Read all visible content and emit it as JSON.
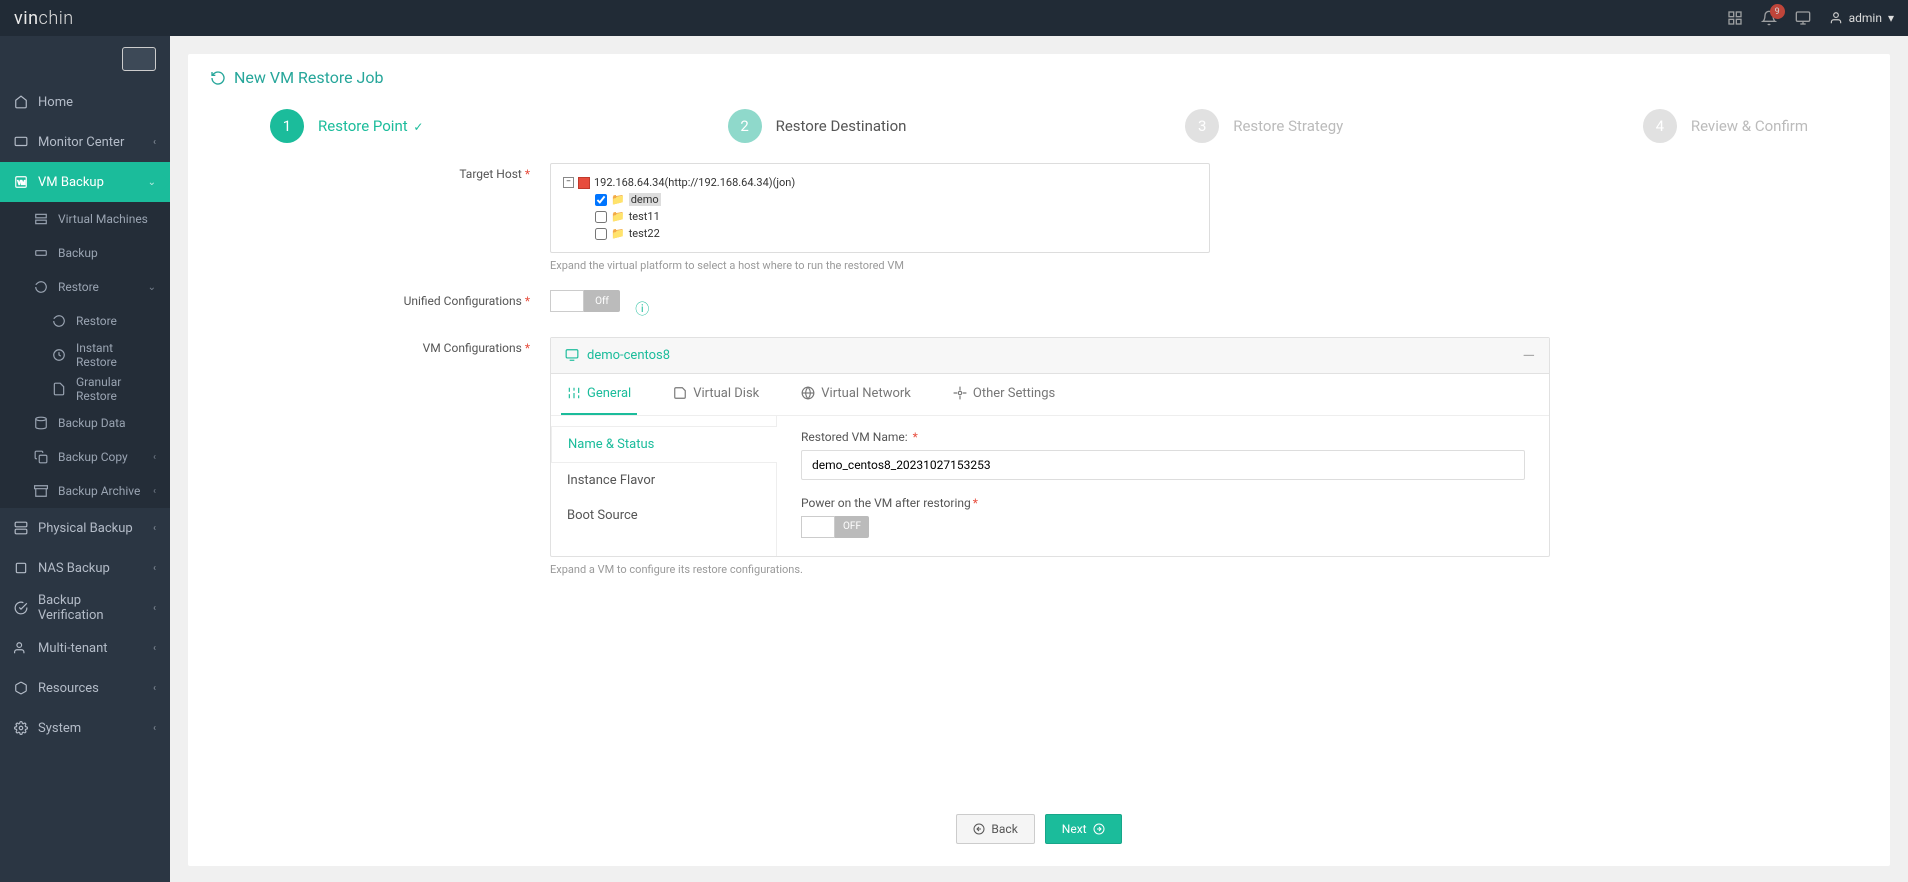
{
  "brand_prefix": "vin",
  "brand_suffix": "chin",
  "notification_count": "9",
  "user": {
    "name": "admin"
  },
  "sidebar": {
    "items": [
      {
        "label": "Home",
        "icon": "home"
      },
      {
        "label": "Monitor Center",
        "icon": "monitor",
        "expandable": true
      },
      {
        "label": "VM Backup",
        "icon": "vm",
        "expandable": true,
        "active": true
      },
      {
        "label": "Physical Backup",
        "icon": "physical",
        "expandable": true
      },
      {
        "label": "NAS Backup",
        "icon": "nas",
        "expandable": true
      },
      {
        "label": "Backup Verification",
        "icon": "verify",
        "expandable": true
      },
      {
        "label": "Multi-tenant",
        "icon": "tenant",
        "expandable": true
      },
      {
        "label": "Resources",
        "icon": "resources",
        "expandable": true
      },
      {
        "label": "System",
        "icon": "system",
        "expandable": true
      }
    ],
    "vm_sub": [
      {
        "label": "Virtual Machines"
      },
      {
        "label": "Backup"
      },
      {
        "label": "Restore",
        "expandable": true,
        "open": true
      },
      {
        "label": "Backup Data"
      },
      {
        "label": "Backup Copy",
        "expandable": true
      },
      {
        "label": "Backup Archive",
        "expandable": true
      }
    ],
    "restore_sub": [
      {
        "label": "Restore"
      },
      {
        "label": "Instant Restore"
      },
      {
        "label": "Granular Restore"
      }
    ]
  },
  "page": {
    "title": "New VM Restore Job"
  },
  "stepper": {
    "steps": [
      {
        "num": "1",
        "label": "Restore Point",
        "done": true
      },
      {
        "num": "2",
        "label": "Restore Destination",
        "current": true
      },
      {
        "num": "3",
        "label": "Restore Strategy"
      },
      {
        "num": "4",
        "label": "Review & Confirm"
      }
    ]
  },
  "form": {
    "target_host_label": "Target Host",
    "tree": {
      "root": "192.168.64.34(http://192.168.64.34)(jon)",
      "children": [
        {
          "label": "demo",
          "checked": true
        },
        {
          "label": "test11",
          "checked": false
        },
        {
          "label": "test22",
          "checked": false
        }
      ]
    },
    "target_host_hint": "Expand the virtual platform to select a host where to run the restored VM",
    "unified_label": "Unified Configurations",
    "unified_toggle_off": "Off",
    "vmconf_label": "VM Configurations",
    "vmconf_hint": "Expand a VM to configure its restore configurations."
  },
  "vmconf": {
    "vm_name": "demo-centos8",
    "tabs": [
      {
        "label": "General",
        "active": true
      },
      {
        "label": "Virtual Disk"
      },
      {
        "label": "Virtual Network"
      },
      {
        "label": "Other Settings"
      }
    ],
    "sublist": [
      {
        "label": "Name & Status",
        "active": true
      },
      {
        "label": "Instance Flavor"
      },
      {
        "label": "Boot Source"
      }
    ],
    "fields": {
      "restored_name_label": "Restored VM Name:",
      "restored_name_value": "demo_centos8_20231027153253",
      "power_on_label": "Power on the VM after restoring",
      "power_on_off": "OFF"
    }
  },
  "buttons": {
    "back": "Back",
    "next": "Next"
  }
}
